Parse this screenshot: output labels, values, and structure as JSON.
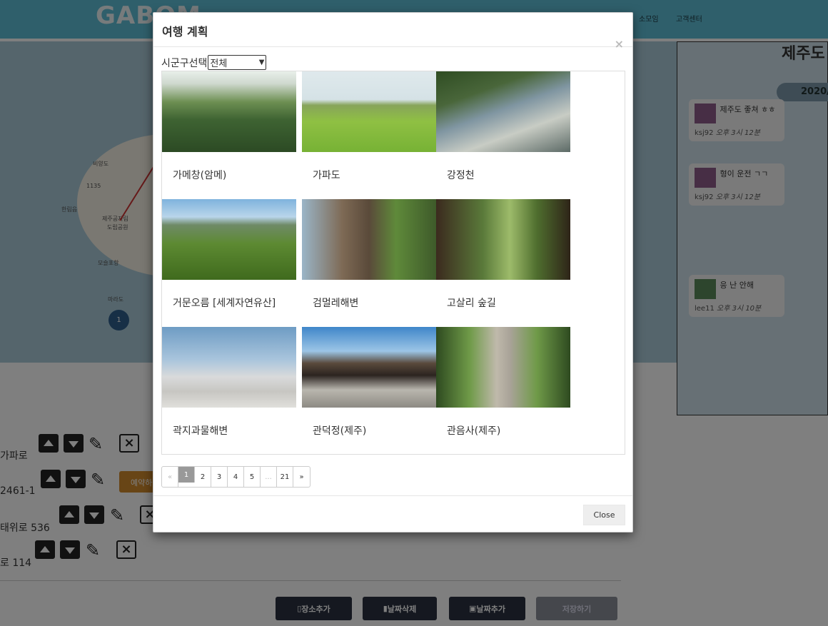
{
  "header": {
    "logo": "GABOM",
    "nav_items": [
      "소모임",
      "고객센터"
    ]
  },
  "map": {
    "labels": [
      "비양도",
      "1135",
      "한림읍",
      "제주공자림",
      "도립공원",
      "모슬포항",
      "마라도"
    ],
    "pin_number": "1"
  },
  "side_panel": {
    "title": "제주도",
    "date": "2020/",
    "messages": [
      {
        "text": "제주도 좋쳐 ㅎㅎ",
        "user": "ksj92",
        "time": "오후 3시 12분"
      },
      {
        "text": "형이 운전 ㄱㄱ",
        "user": "ksj92",
        "time": "오후 3시 12분"
      },
      {
        "text": "응 난 안해",
        "user": "lee11",
        "time": "오후 3시 10분"
      }
    ]
  },
  "places": [
    {
      "addr": "가파로"
    },
    {
      "addr": "2461-1"
    },
    {
      "addr": "태위로 536"
    },
    {
      "addr": "로 114"
    }
  ],
  "reserve_label": "예약하",
  "actions": {
    "add_place": "장소추가",
    "delete_day": "날짜삭제",
    "add_day": "날짜추가",
    "save": "저장하기"
  },
  "modal": {
    "title": "여행 계획",
    "close_icon": "×",
    "filter_label": "시군구선택",
    "filter_value": "전체",
    "places": [
      {
        "name": "가메창(암메)",
        "icon": "landscape-forest"
      },
      {
        "name": "가파도",
        "icon": "barley-field"
      },
      {
        "name": "강정천",
        "icon": "river-rocks"
      },
      {
        "name": "거문오름 [세계자연유산]",
        "icon": "green-hills"
      },
      {
        "name": "검멀레해변",
        "icon": "coastal-statue"
      },
      {
        "name": "고살리 숲길",
        "icon": "forest-path"
      },
      {
        "name": "곽지과물해변",
        "icon": "beach-statues"
      },
      {
        "name": "관덕정(제주)",
        "icon": "traditional-pavilion"
      },
      {
        "name": "관음사(제주)",
        "icon": "temple-path"
      }
    ],
    "pagination": [
      "«",
      "1",
      "2",
      "3",
      "4",
      "5",
      "...",
      "21",
      "»"
    ],
    "active_page": "1",
    "close_button": "Close"
  }
}
